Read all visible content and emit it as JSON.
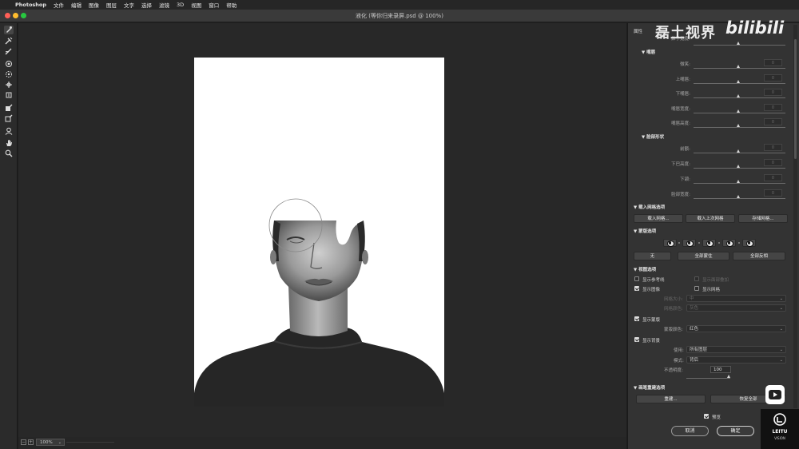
{
  "menubar": {
    "app": "Photoshop",
    "items": [
      "文件",
      "编辑",
      "图像",
      "图层",
      "文字",
      "选择",
      "滤镜",
      "3D",
      "视图",
      "窗口",
      "帮助"
    ]
  },
  "window": {
    "title": "液化 (等你归来录屏.psd @ 100%)"
  },
  "watermark": {
    "text": "磊土视界",
    "bili": "bilibili",
    "leitu": "LEITU",
    "vision": "VISION"
  },
  "status": {
    "zoom": "100%"
  },
  "panel": {
    "tab": "属性",
    "partial_label": "鼻子宽度:",
    "mouth_header": "嘴唇",
    "mouth_sliders": [
      "微笑:",
      "上嘴唇:",
      "下嘴唇:",
      "嘴唇宽度:",
      "嘴唇高度:"
    ],
    "mouth_values": [
      "0",
      "0",
      "0",
      "0",
      "0"
    ],
    "faceshape_header": "脸部形状",
    "faceshape_sliders": [
      "前额:",
      "下巴高度:",
      "下颌:",
      "脸部宽度:"
    ],
    "faceshape_values": [
      "0",
      "0",
      "0",
      "0"
    ],
    "load_mesh": {
      "header": "载入网格选项",
      "buttons": [
        "载入网格...",
        "载入上次网格",
        "存储网格..."
      ]
    },
    "mask": {
      "header": "蒙版选项",
      "buttons": [
        "无",
        "全部蒙住",
        "全部反相"
      ]
    },
    "view": {
      "header": "视图选项",
      "show_guides": "显示参考线",
      "show_face_overlay": "显示面部叠加",
      "show_image": "显示图像",
      "show_mesh": "显示网格",
      "mesh_size_label": "网格大小:",
      "mesh_size_value": "中",
      "mesh_color_label": "网格颜色:",
      "mesh_color_value": "灰色"
    },
    "show_mask": {
      "label": "显示蒙版",
      "color_label": "蒙版颜色:",
      "color_value": "红色"
    },
    "show_bg": {
      "label": "显示背景",
      "use_label": "使用:",
      "use_value": "所有图层",
      "mode_label": "模式:",
      "mode_value": "背后",
      "opacity_label": "不透明度:",
      "opacity_value": "100"
    },
    "rebuild": {
      "header": "画笔重建选项",
      "rebuild_btn": "重建...",
      "restore_btn": "恢复全部"
    },
    "preview_label": "预览",
    "cancel": "取消",
    "ok": "确定"
  },
  "colors": {
    "panel_bg": "#333333",
    "workspace_bg": "#282828",
    "canvas_bg": "#ffffff"
  }
}
